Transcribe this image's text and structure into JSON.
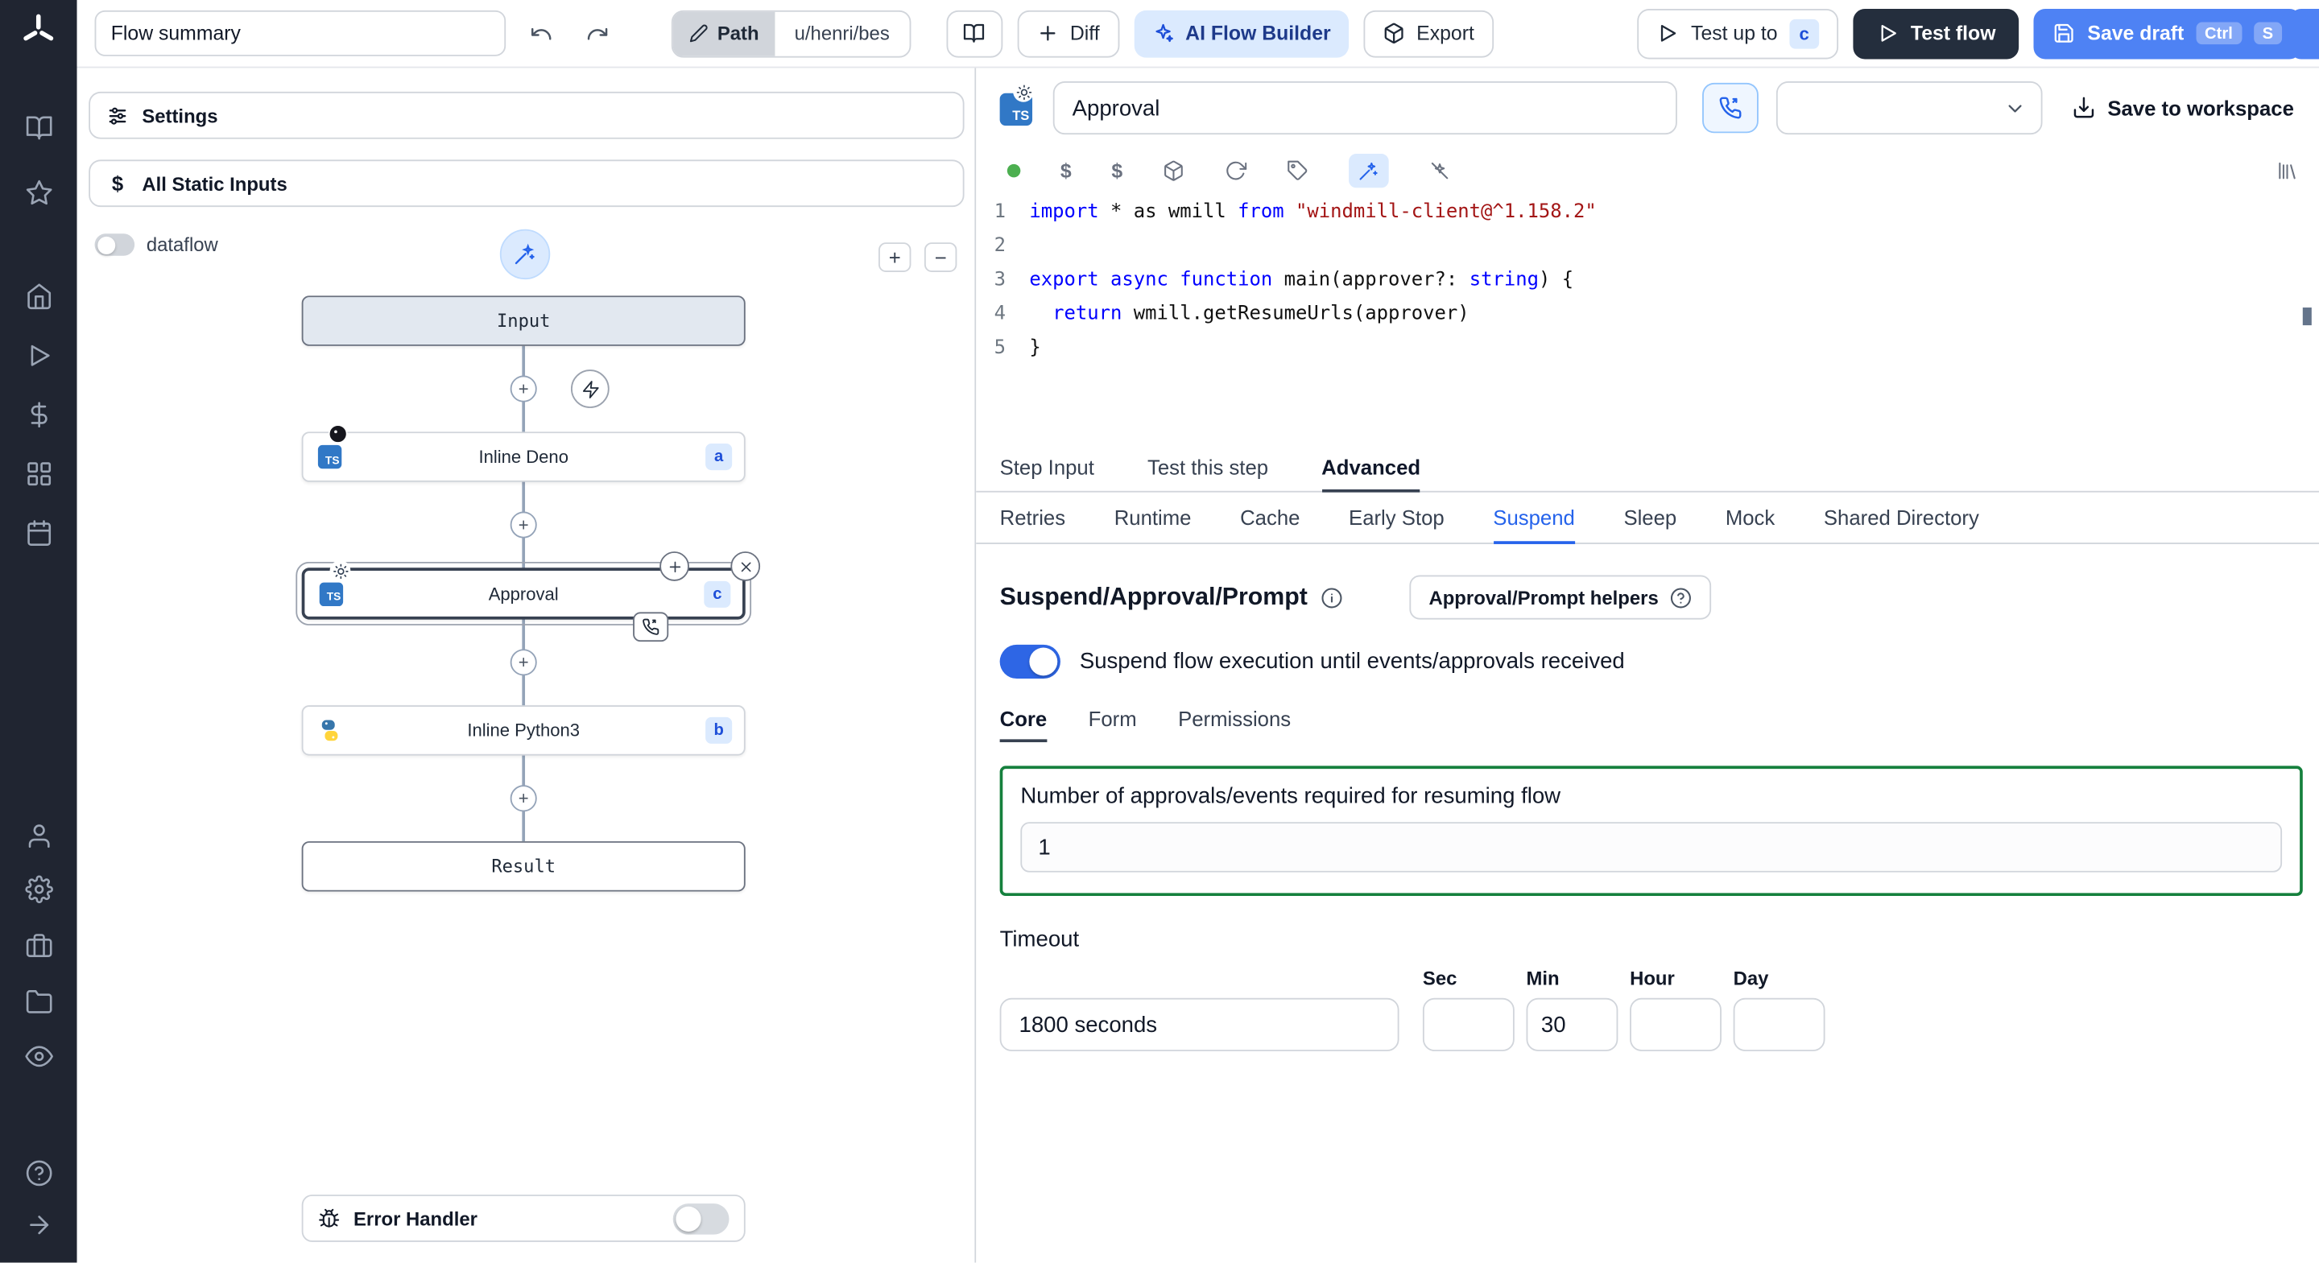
{
  "glyphs": {
    "ts": "TS",
    "dollar": "$",
    "plus": "+",
    "minus": "−"
  },
  "colors": {
    "accent_blue": "#2563eb",
    "light_blue_bg": "#dbeafe",
    "dark_button": "#242e3d",
    "sidebar_bg": "#202531",
    "green_border": "#15803d",
    "code_keyword": "#0000ff",
    "code_string": "#a31515",
    "status_green": "#4caf50"
  },
  "topbar": {
    "flow_summary": "Flow summary",
    "path_label": "Path",
    "path_value": "u/henri/bes",
    "diff_label": "Diff",
    "ai_flow_builder_label": "AI Flow Builder",
    "export_label": "Export",
    "test_up_to_label": "Test up to",
    "test_up_to_badge": "c",
    "test_flow_label": "Test flow",
    "save_draft_label": "Save draft",
    "save_draft_kbd_1": "Ctrl",
    "save_draft_kbd_2": "S"
  },
  "flow_panel": {
    "settings_label": "Settings",
    "static_inputs_label": "All Static Inputs",
    "dataflow_label": "dataflow",
    "nodes": {
      "input_label": "Input",
      "deno_label": "Inline Deno",
      "deno_badge": "a",
      "approval_label": "Approval",
      "approval_badge": "c",
      "python_label": "Inline Python3",
      "python_badge": "b",
      "result_label": "Result"
    },
    "error_handler_label": "Error Handler"
  },
  "editor": {
    "step_name": "Approval",
    "save_to_workspace_label": "Save to workspace",
    "code_lines": [
      {
        "n": "1",
        "parts": [
          [
            "kw",
            "import"
          ],
          [
            "pl",
            " * as wmill "
          ],
          [
            "kw",
            "from"
          ],
          [
            "pl",
            " "
          ],
          [
            "str",
            "\"windmill-client@^1.158.2\""
          ]
        ]
      },
      {
        "n": "2",
        "parts": []
      },
      {
        "n": "3",
        "parts": [
          [
            "kw",
            "export"
          ],
          [
            "pl",
            " "
          ],
          [
            "kw",
            "async"
          ],
          [
            "pl",
            " "
          ],
          [
            "kw",
            "function"
          ],
          [
            "pl",
            " main(approver?: "
          ],
          [
            "kw",
            "string"
          ],
          [
            "pl",
            ") {"
          ]
        ]
      },
      {
        "n": "4",
        "parts": [
          [
            "pl",
            "  "
          ],
          [
            "kw",
            "return"
          ],
          [
            "pl",
            " wmill.getResumeUrls(approver)"
          ]
        ]
      },
      {
        "n": "5",
        "parts": [
          [
            "pl",
            "}"
          ]
        ]
      }
    ],
    "tabs": [
      "Step Input",
      "Test this step",
      "Advanced"
    ],
    "adv_tabs": [
      "Retries",
      "Runtime",
      "Cache",
      "Early Stop",
      "Suspend",
      "Sleep",
      "Mock",
      "Shared Directory"
    ],
    "suspend": {
      "heading": "Suspend/Approval/Prompt",
      "helpers_label": "Approval/Prompt helpers",
      "toggle_label": "Suspend flow execution until events/approvals received",
      "sub_tabs": [
        "Core",
        "Form",
        "Permissions"
      ],
      "approvals_label": "Number of approvals/events required for resuming flow",
      "approvals_value": "1",
      "timeout_label": "Timeout",
      "timeout_value": "1800 seconds",
      "unit_sec_label": "Sec",
      "unit_sec_value": "",
      "unit_min_label": "Min",
      "unit_min_value": "30",
      "unit_hour_label": "Hour",
      "unit_hour_value": "",
      "unit_day_label": "Day",
      "unit_day_value": ""
    }
  }
}
